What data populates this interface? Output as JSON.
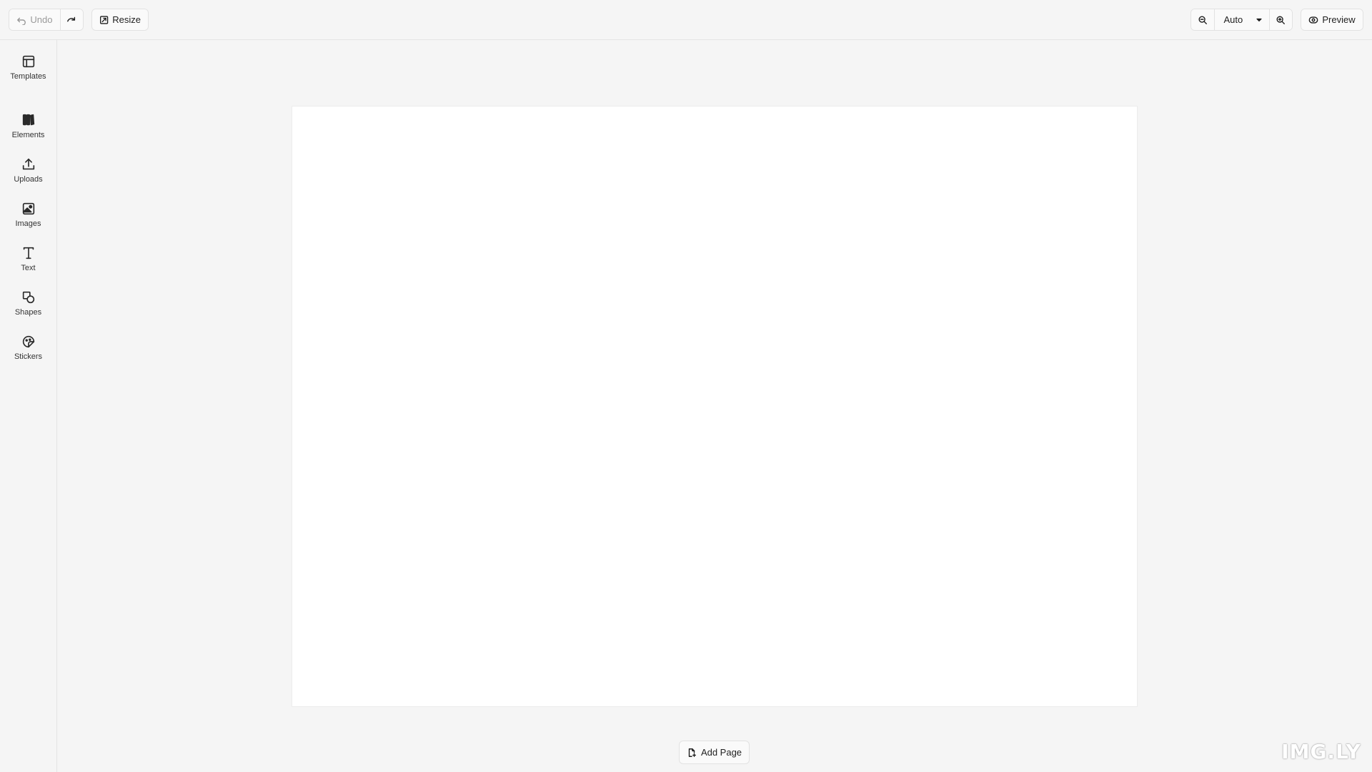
{
  "toolbar": {
    "undo_label": "Undo",
    "resize_label": "Resize",
    "zoom_value": "Auto",
    "preview_label": "Preview"
  },
  "sidebar": {
    "items": [
      {
        "label": "Templates",
        "icon": "templates-icon"
      },
      {
        "label": "Elements",
        "icon": "elements-icon"
      },
      {
        "label": "Uploads",
        "icon": "upload-icon"
      },
      {
        "label": "Images",
        "icon": "image-icon"
      },
      {
        "label": "Text",
        "icon": "text-icon"
      },
      {
        "label": "Shapes",
        "icon": "shapes-icon"
      },
      {
        "label": "Stickers",
        "icon": "sticker-icon"
      }
    ]
  },
  "canvas": {
    "add_page_label": "Add Page"
  },
  "watermark": {
    "text": "IMG.LY"
  }
}
